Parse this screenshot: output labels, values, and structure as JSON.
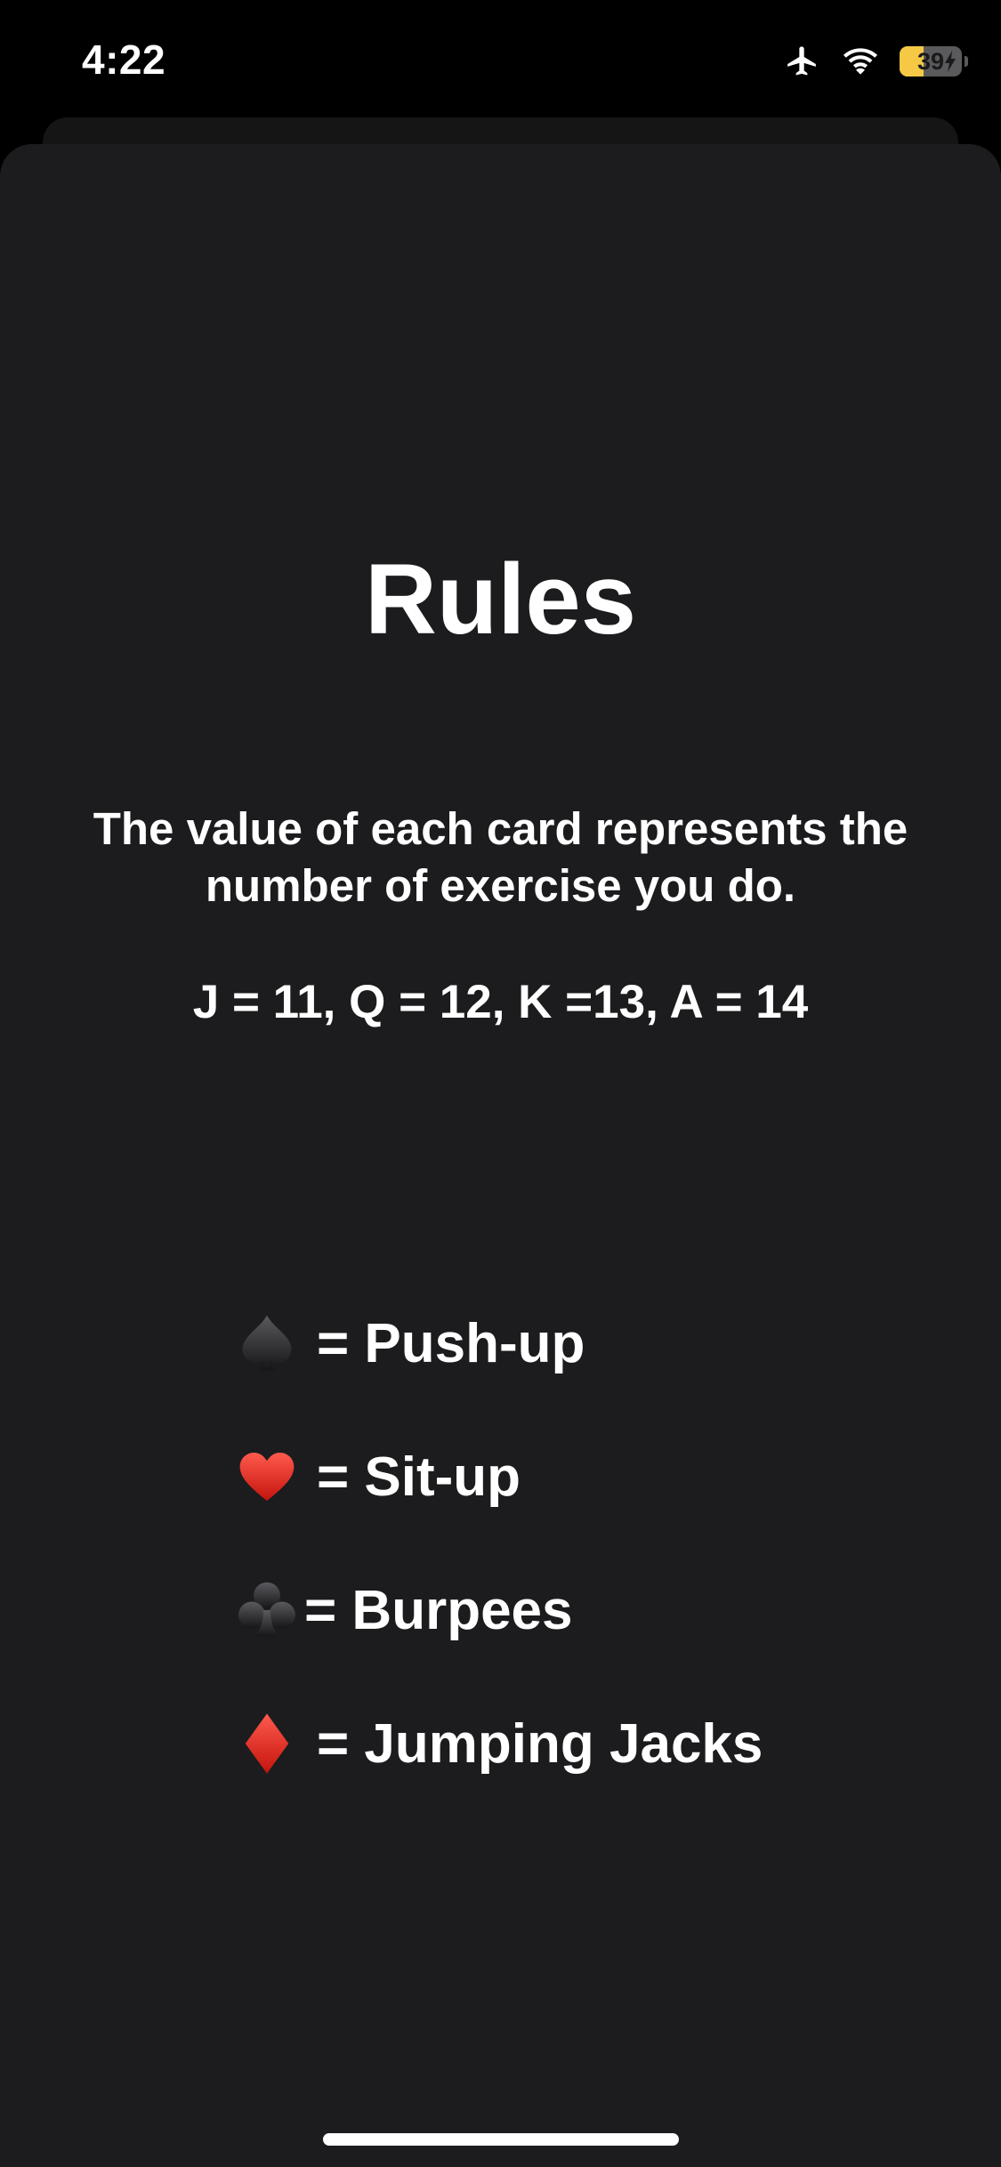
{
  "status_bar": {
    "time": "4:22",
    "battery_level": "39",
    "battery_percent": 39,
    "battery_color": "#f5c945",
    "airplane_mode": true,
    "wifi": "connected",
    "charging": true
  },
  "rules": {
    "title": "Rules",
    "description": "The value of each card represents the number of exercise you do.",
    "values_line": "J = 11, Q = 12, K =13, A = 14",
    "suits": [
      {
        "icon": "spade-icon",
        "label": "= Push-up",
        "color": "#2b2b2d"
      },
      {
        "icon": "heart-icon",
        "label": "= Sit-up",
        "color": "#e3281f"
      },
      {
        "icon": "club-icon",
        "label": "= Burpees",
        "color": "#2b2b2d"
      },
      {
        "icon": "diamond-icon",
        "label": "= Jumping Jacks",
        "color": "#d8261c"
      }
    ]
  },
  "colors": {
    "background": "#000000",
    "sheet": "#1c1c1e",
    "text": "#ffffff"
  }
}
